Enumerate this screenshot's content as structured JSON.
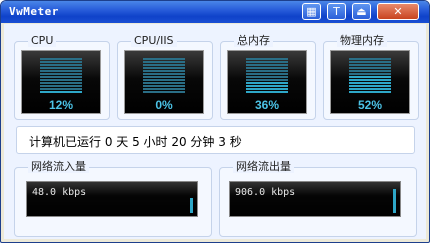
{
  "window": {
    "title": "VwMeter"
  },
  "titlebar_buttons": [
    {
      "name": "theme-button",
      "glyph": "▦"
    },
    {
      "name": "topmost-button",
      "glyph": "T"
    },
    {
      "name": "minimize-button",
      "glyph": "⏏"
    },
    {
      "name": "close-button",
      "glyph": "✕"
    }
  ],
  "meters": [
    {
      "label": "CPU",
      "value": "12%",
      "fraction": 0.12
    },
    {
      "label": "CPU/IIS",
      "value": "0%",
      "fraction": 0.0
    },
    {
      "label": "总内存",
      "value": "36%",
      "fraction": 0.36
    },
    {
      "label": "物理内存",
      "value": "52%",
      "fraction": 0.52
    }
  ],
  "runtime": {
    "text": "计算机已运行 0 天 5 小时 20 分钟 3 秒"
  },
  "network": {
    "in": {
      "label": "网络流入量",
      "value": "48.0 kbps",
      "level": 0.55
    },
    "out": {
      "label": "网络流出量",
      "value": "906.0 kbps",
      "level": 0.85
    }
  },
  "colors": {
    "accent": "#2ea7c8",
    "titlebar": "#2458d8"
  }
}
